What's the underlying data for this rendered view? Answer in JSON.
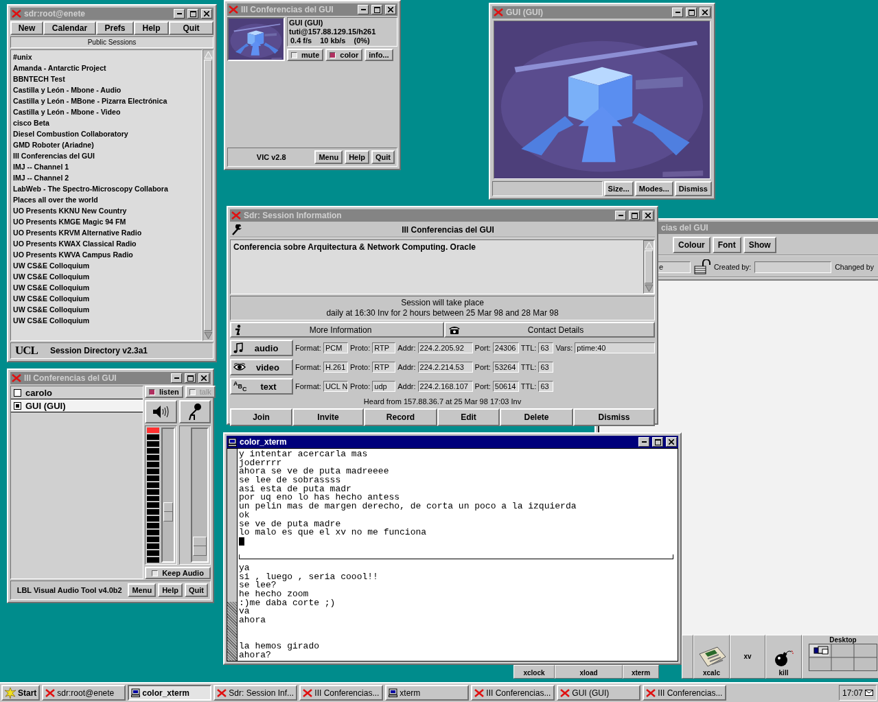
{
  "whiteboard": {
    "title": "cias del GUI",
    "active": false,
    "tools": [
      "Colour",
      "Font",
      "Show"
    ],
    "name_value": "e",
    "locked": false,
    "created_label": "Created by:",
    "changed_label": "Changed by"
  },
  "button_bar": {
    "launchers": [
      {
        "kind": "clock",
        "label": "xclock"
      },
      {
        "kind": "load",
        "label": "xload"
      },
      {
        "kind": "terminal",
        "label": "xterm"
      },
      {
        "kind": "blank"
      },
      {
        "kind": "calculator",
        "label": "xcalc"
      },
      {
        "kind": "viewer",
        "label": "xv"
      },
      {
        "kind": "bomb",
        "label": "kill"
      }
    ],
    "pager_title": "Desktop"
  },
  "video_window": {
    "title": "GUI (GUI)",
    "active": false,
    "buttons": [
      "Size...",
      "Modes...",
      "Dismiss"
    ]
  },
  "vic": {
    "title": "III Conferencias del GUI",
    "active": false,
    "source_name": "GUI (GUI)",
    "source_address": "tuti@157.88.129.15/h261",
    "stats": [
      "0.4 f/s",
      "10 kb/s",
      "(0%)"
    ],
    "toggles": [
      {
        "label": "mute",
        "checked": false
      },
      {
        "label": "color",
        "checked": true
      }
    ],
    "info_button": "info...",
    "version": "VIC v2.8",
    "buttons": [
      "Menu",
      "Help",
      "Quit"
    ]
  },
  "sdr": {
    "title": "sdr:root@enete",
    "active": false,
    "menu": [
      "New",
      "Calendar",
      "Prefs",
      "Help",
      "Quit"
    ],
    "list_title": "Public Sessions",
    "sessions": [
      "#unix",
      "Amanda - Antarctic Project",
      "BBNTECH Test",
      "Castilla y León - Mbone - Audio",
      "Castilla y León - MBone - Pizarra Electrónica",
      "Castilla y León - Mbone - Video",
      "cisco Beta",
      "Diesel Combustion Collaboratory",
      "GMD Roboter (Ariadne)",
      "III Conferencias del GUI",
      "IMJ -- Channel 1",
      "IMJ -- Channel 2",
      "LabWeb - The Spectro-Microscopy Collabora",
      "Places all over the world",
      "UO Presents KKNU New Country",
      "UO Presents KMGE Magic 94 FM",
      "UO Presents KRVM Alternative Radio",
      "UO Presents KWAX Classical Radio",
      "UO Presents KWVA Campus Radio",
      "UW CS&E Colloquium",
      "UW CS&E Colloquium",
      "UW CS&E Colloquium",
      "UW CS&E Colloquium",
      "UW CS&E Colloquium",
      "UW CS&E Colloquium"
    ],
    "logo": "UCL",
    "version": "Session Directory v2.3a1"
  },
  "vat": {
    "title": "III Conferencias del GUI",
    "active": false,
    "participants": [
      {
        "name": "carolo",
        "selected": false
      },
      {
        "name": "GUI (GUI)",
        "selected": true
      }
    ],
    "listen": {
      "label": "listen",
      "checked": true
    },
    "talk": {
      "label": "talk",
      "checked": false,
      "disabled": true
    },
    "output_volume": {
      "level": 0.35
    },
    "input_volume": {
      "level": 0.05
    },
    "keep_audio": {
      "label": "Keep Audio",
      "checked": false
    },
    "version": "LBL Visual Audio Tool v4.0b2",
    "buttons": [
      "Menu",
      "Help",
      "Quit"
    ]
  },
  "session_info": {
    "title": "Sdr: Session Information",
    "active": false,
    "session_name": "III Conferencias del GUI",
    "description": "Conferencia sobre Arquitectura & Network Computing. Oracle",
    "schedule": [
      "Session will take place",
      "daily at 16:30 Inv for 2 hours between 25 Mar 98 and 28 Mar 98"
    ],
    "tabs": [
      {
        "kind": "info",
        "label": "More Information"
      },
      {
        "kind": "contact",
        "label": "Contact Details"
      }
    ],
    "media": [
      {
        "kind": "audio",
        "label": "audio",
        "fields": [
          {
            "label": "Format:",
            "value": "PCM"
          },
          {
            "label": "Proto:",
            "value": "RTP"
          },
          {
            "label": "Addr:",
            "value": "224.2.205.92"
          },
          {
            "label": "Port:",
            "value": "24306"
          },
          {
            "label": "TTL:",
            "value": "63"
          },
          {
            "label": "Vars:",
            "value": "ptime:40"
          }
        ]
      },
      {
        "kind": "video",
        "label": "video",
        "fields": [
          {
            "label": "Format:",
            "value": "H.261"
          },
          {
            "label": "Proto:",
            "value": "RTP"
          },
          {
            "label": "Addr:",
            "value": "224.2.214.53"
          },
          {
            "label": "Port:",
            "value": "53264"
          },
          {
            "label": "TTL:",
            "value": "63"
          }
        ]
      },
      {
        "kind": "text",
        "label": "text",
        "glyphs": "ABC",
        "fields": [
          {
            "label": "Format:",
            "value": "UCL N"
          },
          {
            "label": "Proto:",
            "value": "udp"
          },
          {
            "label": "Addr:",
            "value": "224.2.168.107"
          },
          {
            "label": "Port:",
            "value": "50614"
          },
          {
            "label": "TTL:",
            "value": "63"
          }
        ]
      }
    ],
    "heard_from": "Heard from 157.88.36.7 at 25 Mar 98 17:03 Inv",
    "buttons": [
      "Join",
      "Invite",
      "Record",
      "Edit",
      "Delete",
      "Dismiss"
    ]
  },
  "xterm": {
    "title": "color_xterm",
    "active": true,
    "upper_lines": [
      "y intentar acercarla mas",
      "joderrrr",
      "ahora se ve de puta madreeee",
      "se lee de sobrassss",
      "asi esta de puta madr",
      "por uq eno lo has hecho antess",
      "un pelin mas de margen derecho, de corta un poco a la izquierda",
      "ok",
      "se ve de puta madre",
      "lo malo es que el xv no me funciona"
    ],
    "lower_blocks": [
      [
        "ya",
        "si , luego , seria coool!!",
        "se lee?",
        "he hecho zoom",
        ":)me daba corte ;)",
        "va",
        "ahora"
      ],
      [
        "la hemos girado",
        "ahora?"
      ]
    ]
  },
  "taskbar": {
    "start": "Start",
    "tasks": [
      {
        "kind": "x",
        "label": "sdr:root@enete",
        "selected": false
      },
      {
        "kind": "terminal",
        "label": "color_xterm",
        "selected": true
      },
      {
        "kind": "x",
        "label": "Sdr: Session Inf...",
        "selected": false
      },
      {
        "kind": "x",
        "label": "III Conferencias...",
        "selected": false
      },
      {
        "kind": "terminal",
        "label": "xterm",
        "selected": false
      },
      {
        "kind": "x",
        "label": "III Conferencias...",
        "selected": false
      },
      {
        "kind": "x",
        "label": "GUI (GUI)",
        "selected": false
      },
      {
        "kind": "x",
        "label": "III Conferencias...",
        "selected": false
      }
    ],
    "clock": "17:07"
  }
}
